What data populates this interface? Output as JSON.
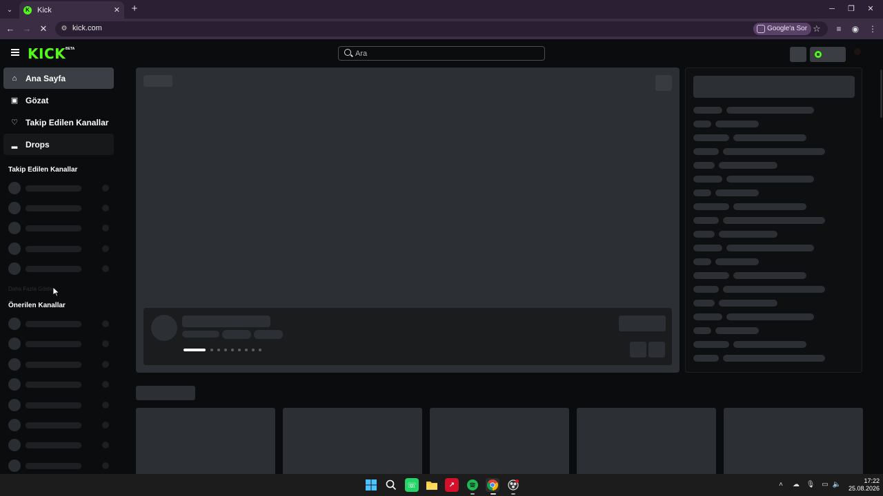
{
  "browser": {
    "tab_title": "Kick",
    "url": "kick.com",
    "google_ask": "Google'a Sor"
  },
  "header": {
    "logo": "KICK",
    "logo_badge": "BETA",
    "search_placeholder": "Ara"
  },
  "sidebar": {
    "nav": [
      {
        "label": "Ana Sayfa",
        "icon": "home-icon"
      },
      {
        "label": "Gözat",
        "icon": "browse-icon"
      },
      {
        "label": "Takip Edilen Kanallar",
        "icon": "heart-icon"
      },
      {
        "label": "Drops",
        "icon": "drops-icon"
      }
    ],
    "following_title": "Takip Edilen Kanallar",
    "show_more": "Daha Fazla Göster",
    "recommended_title": "Önerilen Kanallar"
  },
  "taskbar": {
    "time": "17:22",
    "date": "25.08.2026"
  },
  "colors": {
    "brand": "#53fc18",
    "background": "#0b0c0d",
    "skeleton": "#2c2f33"
  }
}
